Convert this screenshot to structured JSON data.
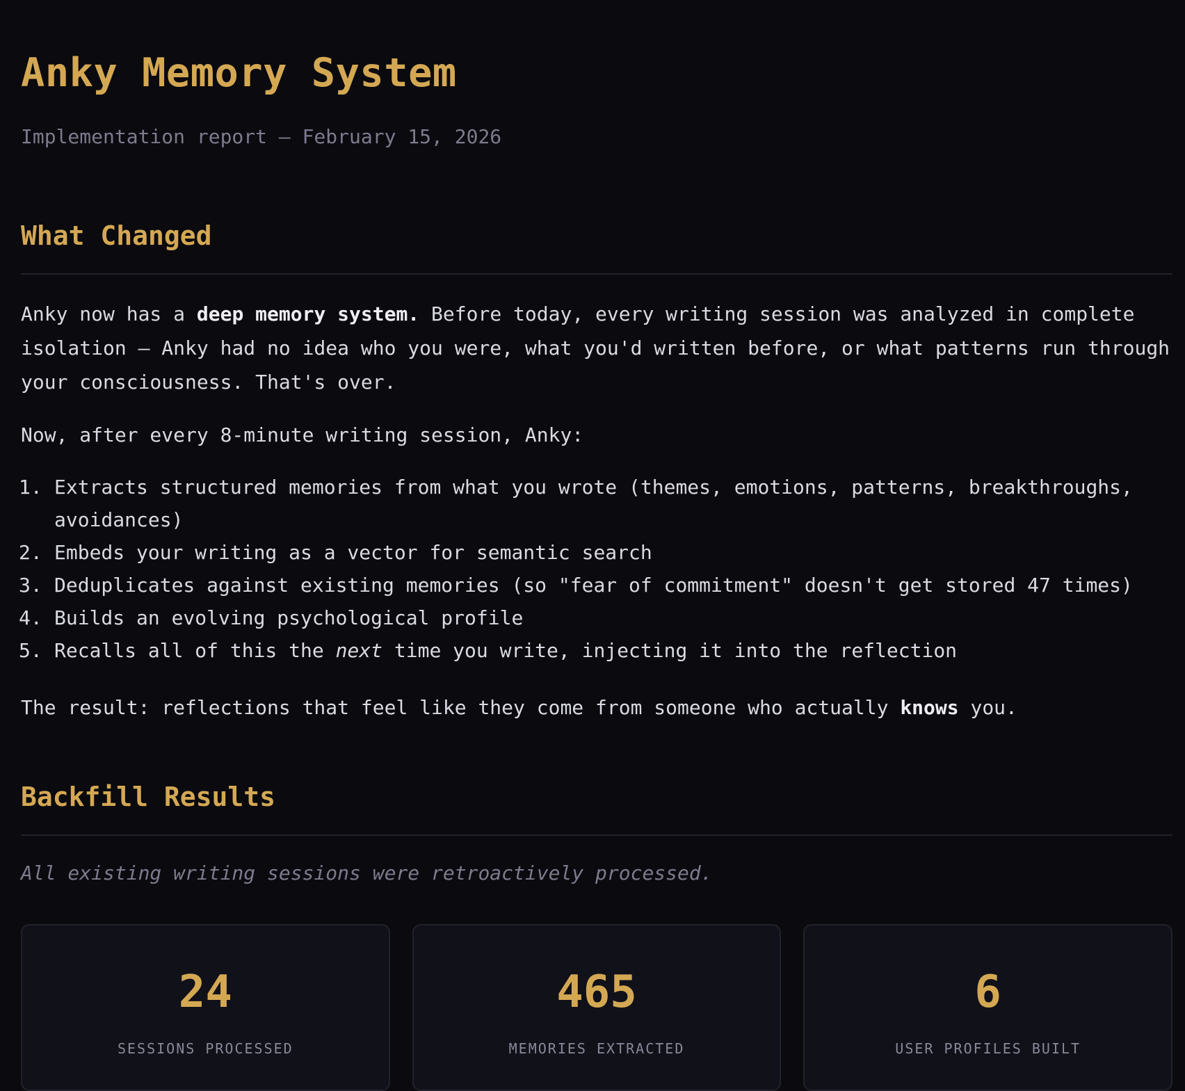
{
  "page": {
    "title": "Anky Memory System",
    "subtitle": "Implementation report — February 15, 2026"
  },
  "what_changed": {
    "heading": "What Changed",
    "intro": {
      "part1": "Anky now has a ",
      "bold": "deep memory system.",
      "part2": " Before today, every writing session was analyzed in complete isolation — Anky had no idea who you were, what you'd written before, or what patterns run through your consciousness. That's over."
    },
    "now_text": "Now, after every 8-minute writing session, Anky:",
    "steps": [
      {
        "num": "1.",
        "text": "Extracts structured memories from what you wrote (themes, emotions, patterns, breakthroughs, avoidances)"
      },
      {
        "num": "2.",
        "text": "Embeds your writing as a vector for semantic search"
      },
      {
        "num": "3.",
        "text": "Deduplicates against existing memories (so \"fear of commitment\" doesn't get stored 47 times)"
      },
      {
        "num": "4.",
        "text": "Builds an evolving psychological profile"
      },
      {
        "num": "5.",
        "pre": "Recalls all of this the ",
        "em": "next",
        "post": " time you write, injecting it into the reflection"
      }
    ],
    "result": {
      "part1": "The result: reflections that feel like they come from someone who actually ",
      "bold": "knows",
      "part2": " you."
    }
  },
  "backfill": {
    "heading": "Backfill Results",
    "note": "All existing writing sessions were retroactively processed.",
    "stats": [
      {
        "value": "24",
        "label": "SESSIONS PROCESSED"
      },
      {
        "value": "465",
        "label": "MEMORIES EXTRACTED"
      },
      {
        "value": "6",
        "label": "USER PROFILES BUILT"
      }
    ]
  },
  "colors": {
    "background": "#0a0a0f",
    "accent": "#d4a853",
    "text": "#dadae2",
    "muted": "#7d7b8d",
    "card": "#11111a",
    "border": "#22222c"
  }
}
